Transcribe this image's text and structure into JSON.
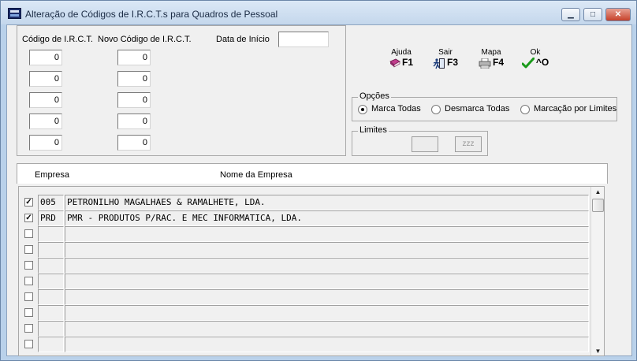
{
  "window": {
    "title": "Alteração de Códigos de I.R.C.T.s para Quadros de Pessoal",
    "minimize": "▁",
    "maximize": "□",
    "close": "✕"
  },
  "codes": {
    "col_current": "Código de I.R.C.T.",
    "col_new": "Novo Código de I.R.C.T.",
    "start_date_label": "Data de Início",
    "start_date_value": "",
    "rows": [
      {
        "current": "0",
        "new": "0"
      },
      {
        "current": "0",
        "new": "0"
      },
      {
        "current": "0",
        "new": "0"
      },
      {
        "current": "0",
        "new": "0"
      },
      {
        "current": "0",
        "new": "0"
      }
    ]
  },
  "toolbar": {
    "help": {
      "label": "Ajuda",
      "key": "F1",
      "icon": "help-book-icon"
    },
    "exit": {
      "label": "Sair",
      "key": "F3",
      "icon": "exit-door-icon"
    },
    "map": {
      "label": "Mapa",
      "key": "F4",
      "icon": "printer-icon"
    },
    "ok": {
      "label": "Ok",
      "key": "^O",
      "icon": "checkmark-icon"
    }
  },
  "options": {
    "title": "Opções",
    "items": [
      {
        "label": "Marca Todas",
        "selected": true
      },
      {
        "label": "Desmarca Todas",
        "selected": false
      },
      {
        "label": "Marcação por Limites",
        "selected": false
      }
    ]
  },
  "limits": {
    "title": "Limites",
    "from": "",
    "to": "zzz"
  },
  "companies": {
    "col_company": "Empresa",
    "col_name": "Nome da Empresa",
    "rows": [
      {
        "checked": true,
        "code": "005",
        "name": "PETRONILHO MAGALHAES & RAMALHETE, LDA."
      },
      {
        "checked": true,
        "code": "PRD",
        "name": "PMR - PRODUTOS P/RAC. E MEC INFORMATICA, LDA."
      },
      {
        "checked": false,
        "code": "",
        "name": ""
      },
      {
        "checked": false,
        "code": "",
        "name": ""
      },
      {
        "checked": false,
        "code": "",
        "name": ""
      },
      {
        "checked": false,
        "code": "",
        "name": ""
      },
      {
        "checked": false,
        "code": "",
        "name": ""
      },
      {
        "checked": false,
        "code": "",
        "name": ""
      },
      {
        "checked": false,
        "code": "",
        "name": ""
      },
      {
        "checked": false,
        "code": "",
        "name": ""
      }
    ]
  },
  "colors": {
    "titlebar": "#c4d7ec",
    "client": "#f0f0f0",
    "check_green": "#1a9a1a",
    "book_pink": "#c23c8c"
  }
}
